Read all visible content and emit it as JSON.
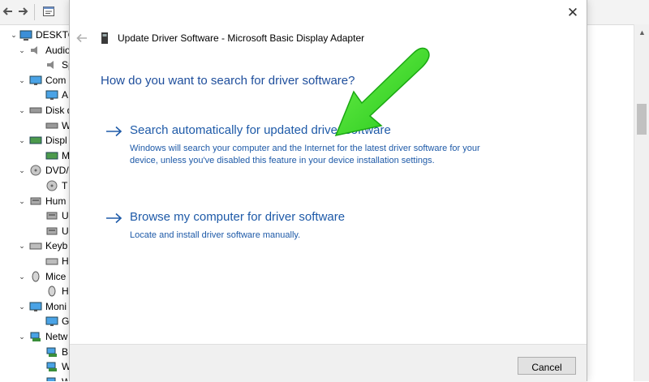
{
  "device_manager": {
    "tree": [
      {
        "indent": 0,
        "expanded": true,
        "icon": "computer-icon",
        "label": "DESKTOP"
      },
      {
        "indent": 1,
        "expanded": true,
        "icon": "speaker-icon",
        "label": "Audio"
      },
      {
        "indent": 2,
        "expanded": null,
        "icon": "speaker-icon",
        "label": "Sp"
      },
      {
        "indent": 1,
        "expanded": true,
        "icon": "monitor-icon",
        "label": "Com"
      },
      {
        "indent": 2,
        "expanded": null,
        "icon": "monitor-icon",
        "label": "A"
      },
      {
        "indent": 1,
        "expanded": true,
        "icon": "disk-icon",
        "label": "Disk d"
      },
      {
        "indent": 2,
        "expanded": null,
        "icon": "disk-icon",
        "label": "W"
      },
      {
        "indent": 1,
        "expanded": true,
        "icon": "display-adapter-icon",
        "label": "Displ"
      },
      {
        "indent": 2,
        "expanded": null,
        "icon": "display-adapter-icon",
        "label": "M"
      },
      {
        "indent": 1,
        "expanded": true,
        "icon": "dvd-icon",
        "label": "DVD/"
      },
      {
        "indent": 2,
        "expanded": null,
        "icon": "dvd-icon",
        "label": "T"
      },
      {
        "indent": 1,
        "expanded": true,
        "icon": "hid-icon",
        "label": "Hum"
      },
      {
        "indent": 2,
        "expanded": null,
        "icon": "hid-icon",
        "label": "U"
      },
      {
        "indent": 2,
        "expanded": null,
        "icon": "hid-icon",
        "label": "U"
      },
      {
        "indent": 1,
        "expanded": true,
        "icon": "keyboard-icon",
        "label": "Keyb"
      },
      {
        "indent": 2,
        "expanded": null,
        "icon": "keyboard-icon",
        "label": "H"
      },
      {
        "indent": 1,
        "expanded": true,
        "icon": "mouse-icon",
        "label": "Mice"
      },
      {
        "indent": 2,
        "expanded": null,
        "icon": "mouse-icon",
        "label": "H"
      },
      {
        "indent": 1,
        "expanded": true,
        "icon": "monitor-icon",
        "label": "Moni"
      },
      {
        "indent": 2,
        "expanded": null,
        "icon": "monitor-icon",
        "label": "G"
      },
      {
        "indent": 1,
        "expanded": true,
        "icon": "network-icon",
        "label": "Netw"
      },
      {
        "indent": 2,
        "expanded": null,
        "icon": "network-icon",
        "label": "B"
      },
      {
        "indent": 2,
        "expanded": null,
        "icon": "network-icon",
        "label": "W"
      },
      {
        "indent": 2,
        "expanded": null,
        "icon": "network-icon",
        "label": "W"
      }
    ]
  },
  "dialog": {
    "title": "Update Driver Software - Microsoft Basic Display Adapter",
    "close_glyph": "✕",
    "heading": "How do you want to search for driver software?",
    "options": [
      {
        "title": "Search automatically for updated driver software",
        "description": "Windows will search your computer and the Internet for the latest driver software for your device, unless you've disabled this feature in your device installation settings."
      },
      {
        "title": "Browse my computer for driver software",
        "description": "Locate and install driver software manually."
      }
    ],
    "cancel_label": "Cancel"
  },
  "colors": {
    "link_blue": "#1e5aa8",
    "heading_blue": "#1e4e9c",
    "annotation_green": "#3ddc2f"
  }
}
